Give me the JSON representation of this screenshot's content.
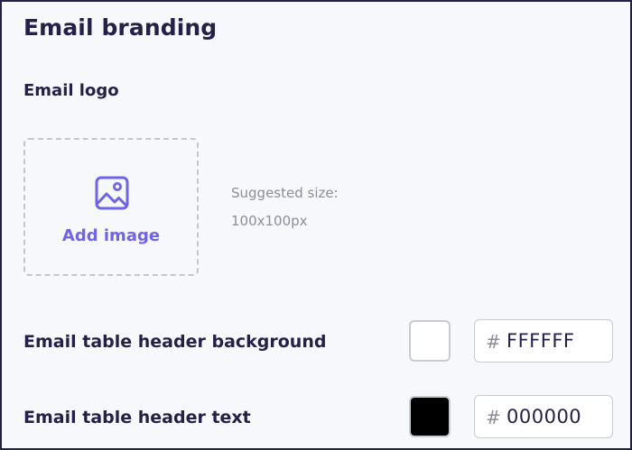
{
  "section": {
    "title": "Email branding"
  },
  "logo": {
    "label": "Email logo",
    "add_image_label": "Add image",
    "icon": "image-icon",
    "hint_line1": "Suggested size:",
    "hint_line2": "100x100px"
  },
  "colors": {
    "header_background": {
      "label": "Email table header background",
      "hash": "#",
      "value": "FFFFFF",
      "swatch_color": "#ffffff"
    },
    "header_text": {
      "label": "Email table header text",
      "hash": "#",
      "value": "000000",
      "swatch_color": "#000000"
    }
  },
  "theme": {
    "accent": "#6f63e6",
    "text": "#23214a",
    "muted": "#8b8d98",
    "background": "#f7f8fc"
  }
}
